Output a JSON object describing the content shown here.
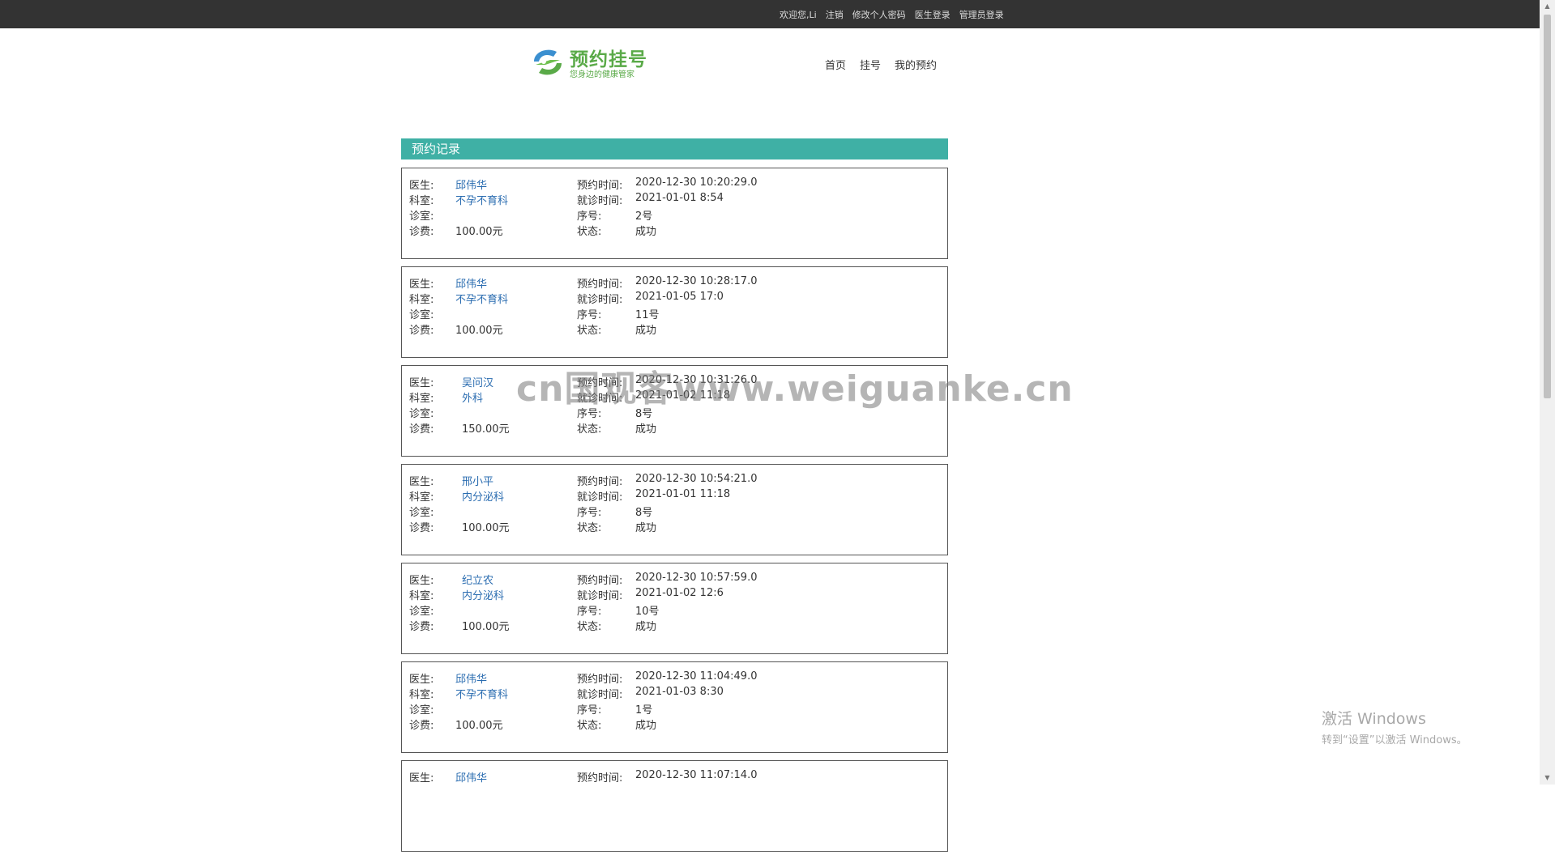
{
  "topbar": {
    "welcome": "欢迎您,Li",
    "logout": "注销",
    "change_password": "修改个人密码",
    "doctor_login": "医生登录",
    "admin_login": "管理员登录"
  },
  "logo": {
    "title": "预约挂号",
    "subtitle": "您身边的健康管家"
  },
  "nav": {
    "home": "首页",
    "register": "挂号",
    "my_appointments": "我的预约"
  },
  "section_title": "预约记录",
  "labels": {
    "doctor": "医生:",
    "department": "科室:",
    "clinic": "诊室:",
    "fee": "诊费:",
    "booking_time": "预约时间:",
    "visit_time": "就诊时间:",
    "number": "序号:",
    "status": "状态:"
  },
  "records": [
    {
      "doctor": "邱伟华",
      "department": "不孕不育科",
      "fee": "100.00元",
      "booking_time": "2020-12-30 10:20:29.0",
      "visit_time": "2021-01-01 8:54",
      "number": "2号",
      "status": "成功"
    },
    {
      "doctor": "邱伟华",
      "department": "不孕不育科",
      "fee": "100.00元",
      "booking_time": "2020-12-30 10:28:17.0",
      "visit_time": "2021-01-05 17:0",
      "number": "11号",
      "status": "成功"
    },
    {
      "doctor": "吴问汉",
      "department": "外科",
      "fee": "150.00元",
      "booking_time": "2020-12-30 10:31:26.0",
      "visit_time": "2021-01-02 11:18",
      "number": "8号",
      "status": "成功"
    },
    {
      "doctor": "邢小平",
      "department": "内分泌科",
      "fee": "100.00元",
      "booking_time": "2020-12-30 10:54:21.0",
      "visit_time": "2021-01-01 11:18",
      "number": "8号",
      "status": "成功"
    },
    {
      "doctor": "纪立农",
      "department": "内分泌科",
      "fee": "100.00元",
      "booking_time": "2020-12-30 10:57:59.0",
      "visit_time": "2021-01-02 12:6",
      "number": "10号",
      "status": "成功"
    },
    {
      "doctor": "邱伟华",
      "department": "不孕不育科",
      "fee": "100.00元",
      "booking_time": "2020-12-30 11:04:49.0",
      "visit_time": "2021-01-03 8:30",
      "number": "1号",
      "status": "成功"
    },
    {
      "doctor": "邱伟华",
      "department": "",
      "fee": "",
      "booking_time": "2020-12-30 11:07:14.0",
      "visit_time": "",
      "number": "",
      "status": ""
    }
  ],
  "watermark": "cn国观客www.weiguanke.cn",
  "windows_activation": {
    "line1": "激活 Windows",
    "line2": "转到“设置”以激活 Windows。"
  },
  "colors": {
    "topbar": "#333333",
    "section_header": "#3fb0a5",
    "link": "#2a6cb0",
    "logo_green": "#5aaa48",
    "logo_blue": "#3b8fd0"
  }
}
